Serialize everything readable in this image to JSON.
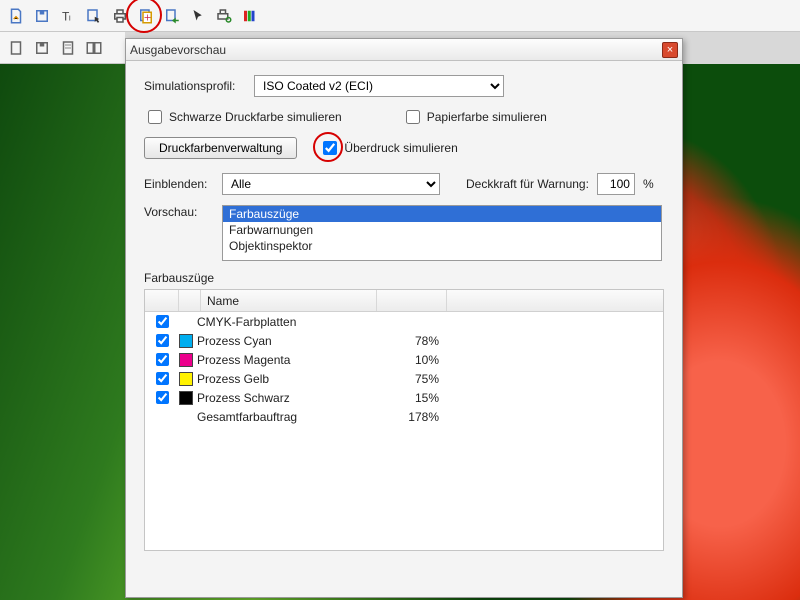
{
  "toolbar_top": {
    "icons": [
      "new-doc",
      "save",
      "text",
      "select",
      "print",
      "preflight",
      "export",
      "pointer",
      "print-setup",
      "color-bars"
    ]
  },
  "dialog": {
    "title": "Ausgabevorschau",
    "close": "×",
    "simprofile_label": "Simulationsprofil:",
    "simprofile_value": "ISO Coated v2 (ECI)",
    "chk_black": "Schwarze Druckfarbe simulieren",
    "chk_paper": "Papierfarbe simulieren",
    "btn_inkmgr": "Druckfarbenverwaltung",
    "chk_overprint": "Überdruck simulieren",
    "einblenden_label": "Einblenden:",
    "einblenden_value": "Alle",
    "opacity_label": "Deckkraft für Warnung:",
    "opacity_value": "100",
    "opacity_unit": "%",
    "vorschau_label": "Vorschau:",
    "vorschau_options": [
      "Farbauszüge",
      "Farbwarnungen",
      "Objektinspektor"
    ],
    "section": "Farbauszüge",
    "table": {
      "col_name": "Name",
      "rows": [
        {
          "chk": true,
          "swatch": null,
          "name": "CMYK-Farbplatten",
          "val": ""
        },
        {
          "chk": true,
          "swatch": "#00AEEF",
          "name": "Prozess Cyan",
          "val": "78%"
        },
        {
          "chk": true,
          "swatch": "#EC008C",
          "name": "Prozess Magenta",
          "val": "10%"
        },
        {
          "chk": true,
          "swatch": "#FFF200",
          "name": "Prozess Gelb",
          "val": "75%"
        },
        {
          "chk": true,
          "swatch": "#000000",
          "name": "Prozess Schwarz",
          "val": "15%"
        },
        {
          "chk": null,
          "swatch": null,
          "name": "Gesamtfarbauftrag",
          "val": "178%"
        }
      ]
    }
  }
}
